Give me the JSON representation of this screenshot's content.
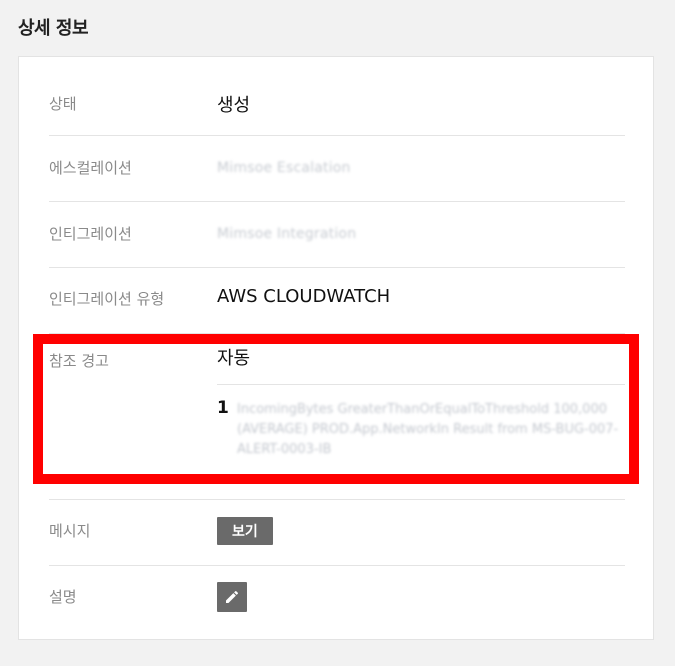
{
  "section_title": "상세 정보",
  "rows": {
    "status": {
      "label": "상태",
      "value": "생성"
    },
    "escalation": {
      "label": "에스컬레이션",
      "value": "Mimsoe Escalation"
    },
    "integration": {
      "label": "인티그레이션",
      "value": "Mimsoe Integration"
    },
    "integration_type": {
      "label": "인티그레이션 유형",
      "value": "AWS CLOUDWATCH"
    },
    "reference_alert": {
      "label": "참조 경고",
      "mode": "자동",
      "items": [
        {
          "number": "1",
          "text": "IncomingBytes GreaterThanOrEqualToThreshold 100,000 (AVERAGE) PROD.App.NetworkIn Result from MS-BUG-007-ALERT-0003-IB"
        }
      ]
    },
    "message": {
      "label": "메시지",
      "button_label": "보기"
    },
    "description": {
      "label": "설명",
      "edit_icon": "pencil-icon"
    }
  },
  "colors": {
    "highlight": "#ff0000",
    "button_bg": "#6a6a6a"
  }
}
